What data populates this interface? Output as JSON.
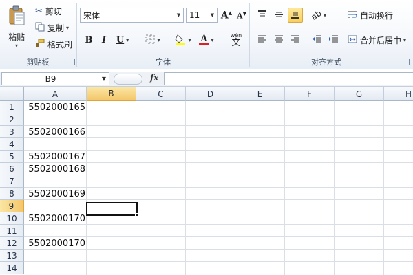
{
  "ribbon": {
    "clipboard": {
      "paste_label": "粘贴",
      "cut_label": "剪切",
      "copy_label": "复制",
      "format_painter_label": "格式刷",
      "group_label": "剪贴板"
    },
    "font": {
      "font_name": "宋体",
      "font_size": "11",
      "bold": "B",
      "italic": "I",
      "underline": "U",
      "font_color_glyph": "A",
      "wen_glyph": "wén",
      "group_label": "字体"
    },
    "alignment": {
      "wrap_text_label": "自动换行",
      "merge_center_label": "合并后居中",
      "group_label": "对齐方式"
    },
    "colors": {
      "highlight": "#ffff00",
      "font_color": "#e02020",
      "active_button": "#f8cf5a"
    }
  },
  "formula_bar": {
    "name_box": "B9",
    "fx_label": "fx",
    "formula": ""
  },
  "sheet": {
    "columns": [
      "A",
      "B",
      "C",
      "D",
      "E",
      "F",
      "G",
      "H"
    ],
    "selected_column": "B",
    "selected_row": 9,
    "rows": [
      {
        "num": "1",
        "a": "5502000165"
      },
      {
        "num": "2",
        "a": ""
      },
      {
        "num": "3",
        "a": "5502000166"
      },
      {
        "num": "4",
        "a": ""
      },
      {
        "num": "5",
        "a": "5502000167"
      },
      {
        "num": "6",
        "a": "5502000168"
      },
      {
        "num": "7",
        "a": ""
      },
      {
        "num": "8",
        "a": "5502000169"
      },
      {
        "num": "9",
        "a": ""
      },
      {
        "num": "10",
        "a": "5502000170"
      },
      {
        "num": "11",
        "a": ""
      },
      {
        "num": "12",
        "a": "5502000170"
      },
      {
        "num": "13",
        "a": ""
      },
      {
        "num": "14",
        "a": ""
      }
    ]
  }
}
